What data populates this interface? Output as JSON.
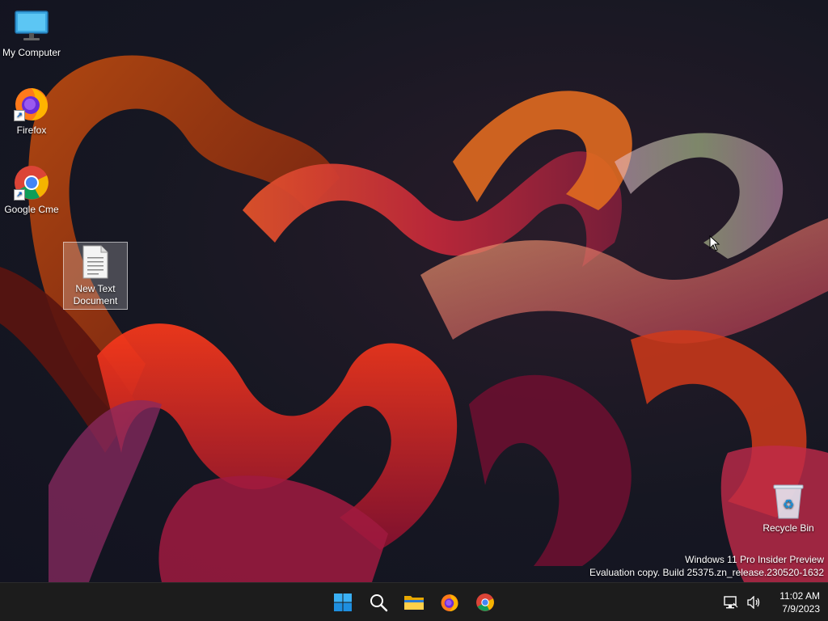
{
  "desktop": {
    "icons": [
      {
        "label": "My Computer",
        "icon": "monitor-icon"
      },
      {
        "label": "Firefox",
        "icon": "firefox-icon"
      },
      {
        "label": "Google Cme",
        "icon": "chrome-icon"
      },
      {
        "label": "New Text Document",
        "icon": "text-document-icon"
      },
      {
        "label": "Recycle Bin",
        "icon": "recycle-bin-icon"
      }
    ]
  },
  "watermark": {
    "line1": "Windows 11 Pro Insider Preview",
    "line2": "Evaluation copy. Build 25375.zn_release.230520-1632"
  },
  "taskbar": {
    "pinned": [
      "start-icon",
      "search-icon",
      "file-explorer-icon",
      "firefox-icon",
      "chrome-icon"
    ],
    "tray": [
      "network-icon",
      "volume-icon"
    ],
    "clock": {
      "time": "11:02 AM",
      "date": "7/9/2023"
    }
  },
  "colors": {
    "taskbar": "#1c1c1c",
    "accent": "#0078d4",
    "desktop_bg": "#14151f"
  }
}
